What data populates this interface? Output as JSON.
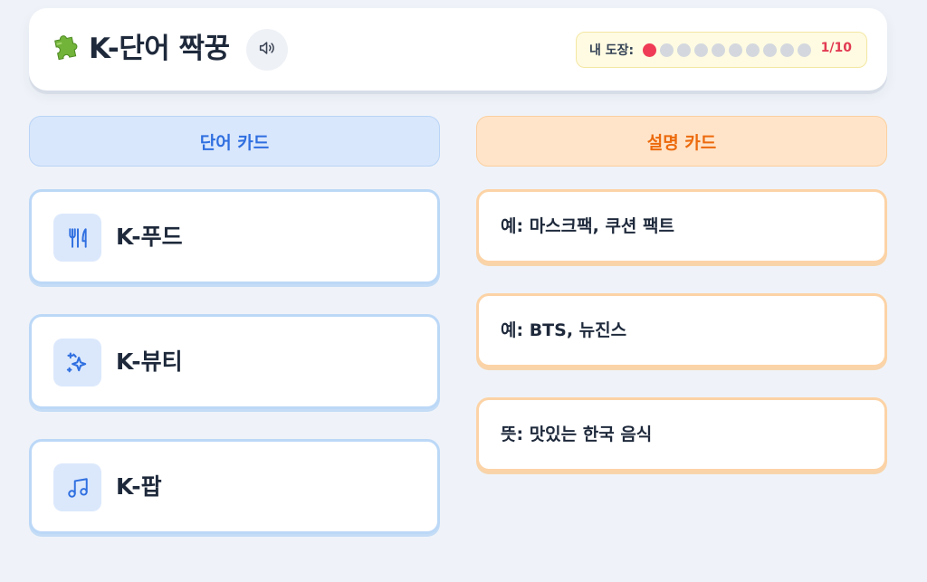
{
  "header": {
    "title": "K-단어 짝꿍",
    "app_icon": "puzzle-icon",
    "sound_icon": "speaker-icon",
    "stamp_label": "내 도장:",
    "stamps_filled": 1,
    "stamps_total": 10,
    "stamp_count": "1/10"
  },
  "columns": {
    "words_title": "단어 카드",
    "descriptions_title": "설명 카드"
  },
  "word_cards": [
    {
      "label": "K-푸드",
      "icon": "fork-knife-icon"
    },
    {
      "label": "K-뷰티",
      "icon": "sparkle-icon"
    },
    {
      "label": "K-팝",
      "icon": "music-note-icon"
    }
  ],
  "description_cards": [
    {
      "label": "예: 마스크팩, 쿠션 팩트"
    },
    {
      "label": "예: BTS, 뉴진스"
    },
    {
      "label": "뜻: 맛있는 한국 음식"
    }
  ],
  "colors": {
    "background": "#eff3f9",
    "word_accent": "#2f6fe0",
    "description_accent": "#ec6a0d",
    "stamp_filled": "#ef3b56",
    "stamp_empty": "#d4d8de"
  }
}
